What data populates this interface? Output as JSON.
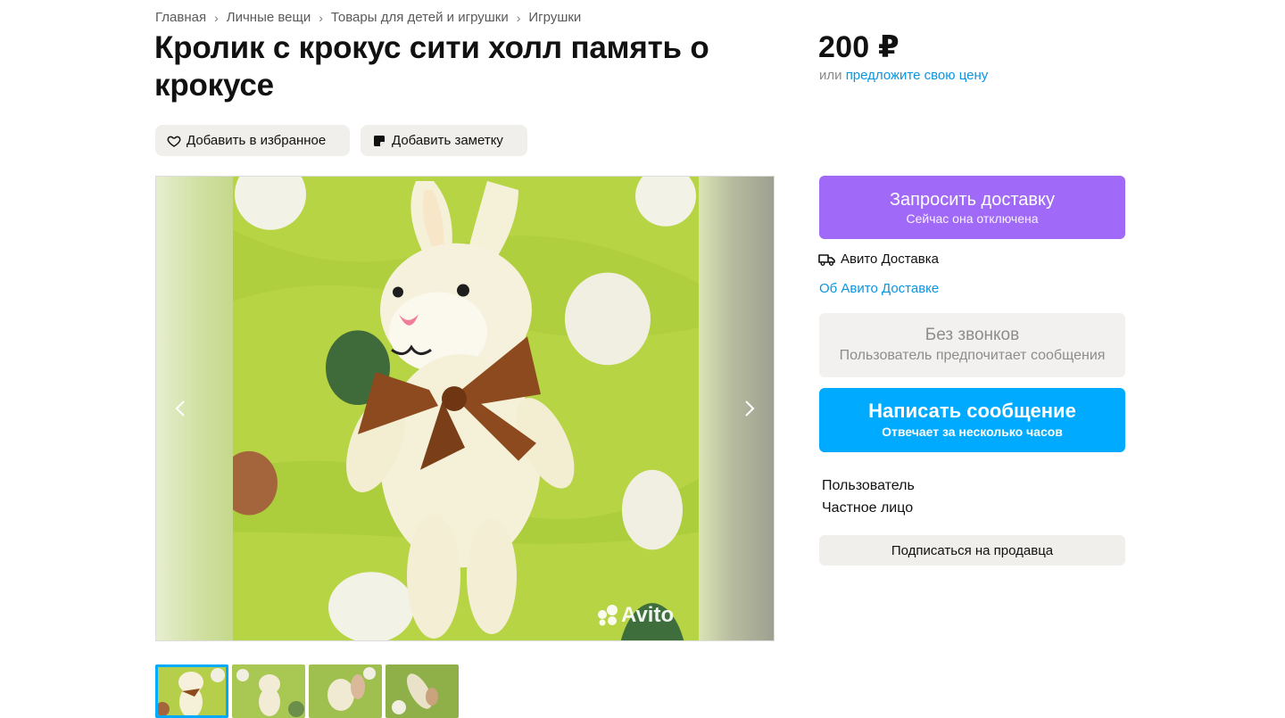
{
  "breadcrumbs": [
    "Главная",
    "Личные вещи",
    "Товары для детей и игрушки",
    "Игрушки"
  ],
  "breadcrumb_separator": "›",
  "title": "Кролик с крокус сити холл память о крокусе",
  "actions": {
    "favorite": {
      "label": "Добавить в избранное",
      "icon": "heart-icon"
    },
    "note": {
      "label": "Добавить заметку",
      "icon": "note-icon"
    }
  },
  "gallery": {
    "watermark": "Avito",
    "prev_icon": "chevron-left-icon",
    "next_icon": "chevron-right-icon",
    "thumbnail_count": 4,
    "active_thumbnail": 1
  },
  "price": {
    "value": "200 ₽",
    "or_text": "или",
    "offer_link": "предложите свою цену"
  },
  "delivery_button": {
    "title": "Запросить доставку",
    "subtitle": "Сейчас она отключена",
    "color": "#a169f7"
  },
  "avito_delivery": {
    "label": "Авито Доставка",
    "icon": "truck-icon",
    "about_link": "Об Авито Доставке"
  },
  "no_calls": {
    "title": "Без звонков",
    "subtitle": "Пользователь предпочитает сообщения"
  },
  "message_button": {
    "title": "Написать сообщение",
    "subtitle": "Отвечает за несколько часов",
    "color": "#00aaff"
  },
  "seller": {
    "name": "Пользователь",
    "type": "Частное лицо",
    "subscribe_label": "Подписаться на продавца"
  },
  "colors": {
    "link": "#0a95e0",
    "chip_bg": "#f0efec"
  }
}
